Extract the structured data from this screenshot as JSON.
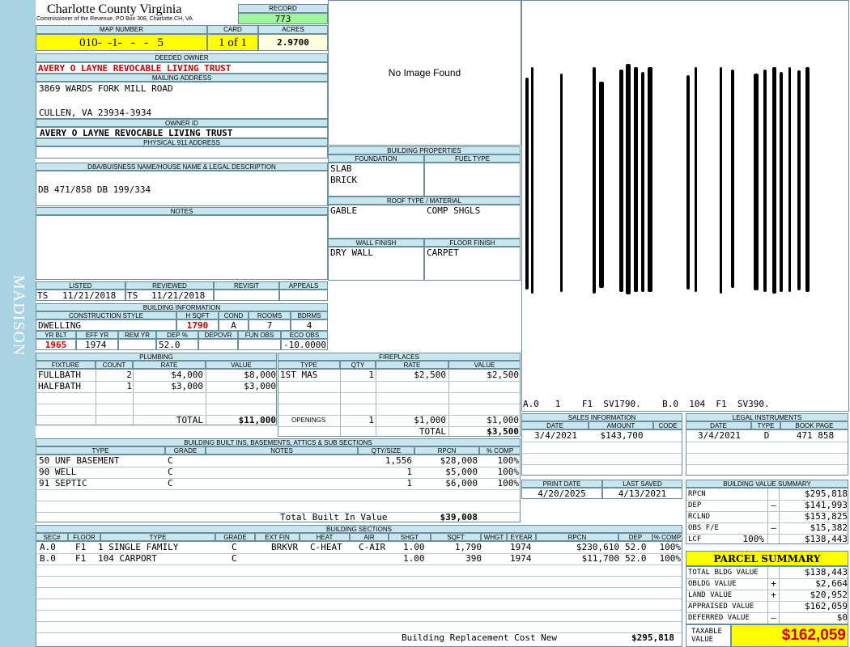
{
  "sidebar": {
    "district": "MADISON"
  },
  "header": {
    "county": "Charlotte County Virginia",
    "office": "Commissioner of the Revenue, PO Box 308, Charlotte CH, VA",
    "record_label": "RECORD",
    "record": "773",
    "map_number_label": "MAP NUMBER",
    "map_number": "010-  -1-   -   -   5",
    "card_label": "CARD",
    "card": "1 of 1",
    "acres_label": "ACRES",
    "acres": "2.9700"
  },
  "owner": {
    "deeded_owner_label": "DEEDED OWNER",
    "deeded_owner": "AVERY O LAYNE REVOCABLE LIVING TRUST",
    "mailing_label": "MAILING ADDRESS",
    "address_line1": "3869 WARDS FORK MILL ROAD",
    "address_line2": "CULLEN, VA 23934-3934",
    "owner_id_label": "OWNER ID",
    "owner_id": "AVERY O LAYNE REVOCABLE LIVING TRUST",
    "physical_label": "PHYSICAL 911 ADDRESS",
    "physical": ""
  },
  "legal": {
    "label": "DBA/BUISNESS NAME/HOUSE NAME & LEGAL DESCRIPTION",
    "text": "DB 471/858 DB 199/334",
    "notes_label": "NOTES",
    "notes": ""
  },
  "image": {
    "no_image": "No Image Found"
  },
  "building_properties": {
    "label": "BUILDING PROPERTIES",
    "foundation_label": "FOUNDATION",
    "foundation": [
      "SLAB",
      "BRICK"
    ],
    "fuel_label": "FUEL TYPE",
    "roof_label": "ROOF TYPE / MATERIAL",
    "roof_type": "GABLE",
    "roof_material": "COMP SHGLS",
    "wall_label": "WALL FINISH",
    "wall": "DRY WALL",
    "floor_label": "FLOOR FINISH",
    "floor": "CARPET"
  },
  "sketch": {
    "labels": "A.0   1    F1  SV1790.    B.0  104  F1  SV390."
  },
  "review": {
    "listed_label": "LISTED",
    "listed_by": "TS",
    "listed_date": "11/21/2018",
    "reviewed_label": "REVIEWED",
    "reviewed_by": "TS",
    "reviewed_date": "11/21/2018",
    "revisit_label": "REVISIT",
    "appeals_label": "APPEALS"
  },
  "building_info": {
    "label": "BUILDING INFORMATION",
    "construction_label": "CONSTRUCTION STYLE",
    "construction": "DWELLING",
    "hsqft_label": "H SQFT",
    "hsqft": "1790",
    "cond_label": "COND",
    "cond": "A",
    "rooms_label": "ROOMS",
    "rooms": "7",
    "bdrms_label": "BDRMS",
    "bdrms": "4",
    "yrblt_label": "YR BLT",
    "yrblt": "1965",
    "effyr_label": "EFF YR",
    "effyr": "1974",
    "remyr_label": "REM YR",
    "remyr": "",
    "dep_label": "DEP %",
    "dep": "52.0",
    "depovr_label": "DEPOVR",
    "depovr": "",
    "funobs_label": "FUN OBS",
    "funobs": "",
    "ecoobs_label": "ECO OBS",
    "ecoobs": "-10.0000"
  },
  "plumbing": {
    "label": "PLUMBING",
    "headers": [
      "FIXTURE",
      "COUNT",
      "RATE",
      "VALUE"
    ],
    "rows": [
      {
        "fixture": "FULLBATH",
        "count": "2",
        "rate": "$4,000",
        "value": "$8,000"
      },
      {
        "fixture": "HALFBATH",
        "count": "1",
        "rate": "$3,000",
        "value": "$3,000"
      }
    ],
    "total_label": "TOTAL",
    "total": "$11,000"
  },
  "fireplaces": {
    "label": "FIREPLACES",
    "headers": [
      "TYPE",
      "QTY",
      "RATE",
      "VALUE"
    ],
    "rows": [
      {
        "type": "1ST MAS",
        "qty": "1",
        "rate": "$2,500",
        "value": "$2,500"
      }
    ],
    "openings_label": "OPENINGS",
    "openings_qty": "1",
    "openings_rate": "$1,000",
    "openings_value": "$1,000",
    "total_label": "TOTAL",
    "total": "$3,500"
  },
  "sales": {
    "label": "SALES INFORMATION",
    "headers": [
      "DATE",
      "AMOUNT",
      "CODE"
    ],
    "rows": [
      {
        "date": "3/4/2021",
        "amount": "$143,700",
        "code": ""
      }
    ]
  },
  "legal_instruments": {
    "label": "LEGAL INSTRUMENTS",
    "headers": [
      "DATE",
      "TYPE",
      "BOOK PAGE"
    ],
    "rows": [
      {
        "date": "3/4/2021",
        "type": "D",
        "bookpage": "471 858"
      }
    ]
  },
  "builtins": {
    "label": "BUILDING BUILT INS, BASEMENTS, ATTICS & SUB SECTIONS",
    "headers": [
      "TYPE",
      "GRADE",
      "NOTES",
      "QTY/SIZE",
      "RPCN",
      "% COMP"
    ],
    "rows": [
      {
        "type": "50 UNF BASEMENT",
        "grade": "C",
        "notes": "",
        "qty": "1,556",
        "rpcn": "$28,008",
        "comp": "100%"
      },
      {
        "type": "90 WELL",
        "grade": "C",
        "notes": "",
        "qty": "1",
        "rpcn": "$5,000",
        "comp": "100%"
      },
      {
        "type": "91 SEPTIC",
        "grade": "C",
        "notes": "",
        "qty": "1",
        "rpcn": "$6,000",
        "comp": "100%"
      }
    ],
    "total_label": "Total Built In Value",
    "total": "$39,008"
  },
  "dates": {
    "print_label": "PRINT DATE",
    "print": "4/20/2025",
    "saved_label": "LAST SAVED",
    "saved": "4/13/2021"
  },
  "value_summary": {
    "label": "BUILDING VALUE SUMMARY",
    "rows": [
      {
        "label": "RPCN",
        "pct": "",
        "sign": "",
        "value": "$295,818"
      },
      {
        "label": "DEP",
        "pct": "",
        "sign": "–",
        "value": "$141,993"
      },
      {
        "label": "RCLND",
        "pct": "",
        "sign": "",
        "value": "$153,825"
      },
      {
        "label": "OBS F/E",
        "pct": "",
        "sign": "–",
        "value": "$15,382"
      },
      {
        "label": "LCF",
        "pct": "100%",
        "sign": "",
        "value": "$138,443"
      }
    ]
  },
  "sections": {
    "label": "BUILDING SECTIONS",
    "headers": [
      "SEC#",
      "FLOOR",
      "TYPE",
      "GRADE",
      "EXT FIN",
      "HEAT",
      "AIR",
      "SHGT",
      "SQFT",
      "WHGT",
      "EYEAR",
      "RPCN",
      "DEP",
      "% COMP"
    ],
    "rows": [
      {
        "sec": "A.0",
        "floor": "F1",
        "type": "1 SINGLE FAMILY",
        "grade": "C",
        "ext": "BRKVR",
        "heat": "C-HEAT",
        "air": "C-AIR",
        "shgt": "1.00",
        "sqft": "1,790",
        "whgt": "",
        "eyear": "1974",
        "rpcn": "$230,610",
        "dep": "52.0",
        "comp": "100%"
      },
      {
        "sec": "B.0",
        "floor": "F1",
        "type": "104 CARPORT",
        "grade": "C",
        "ext": "",
        "heat": "",
        "air": "",
        "shgt": "1.00",
        "sqft": "390",
        "whgt": "",
        "eyear": "1974",
        "rpcn": "$11,700",
        "dep": "52.0",
        "comp": "100%"
      }
    ],
    "replacement_label": "Building Replacement Cost New",
    "replacement": "$295,818"
  },
  "parcel": {
    "title": "PARCEL SUMMARY",
    "rows": [
      {
        "label": "TOTAL BLDG VALUE",
        "sign": "",
        "value": "$138,443"
      },
      {
        "label": "OBLDG VALUE",
        "sign": "+",
        "value": "$2,664"
      },
      {
        "label": "LAND VALUE",
        "sign": "+",
        "value": "$20,952"
      },
      {
        "label": "APPRAISED VALUE",
        "sign": "",
        "value": "$162,059"
      },
      {
        "label": "DEFERRED VALUE",
        "sign": "–",
        "value": "$0"
      }
    ],
    "taxable_label_1": "TAXABLE",
    "taxable_label_2": "VALUE",
    "taxable": "$162,059"
  },
  "colors": {
    "header_bg": "#c9e6f0",
    "sidebar": "#a9d3e3",
    "highlight": "#ffff00",
    "record": "#9ef59e",
    "alert_red": "#d00000"
  }
}
